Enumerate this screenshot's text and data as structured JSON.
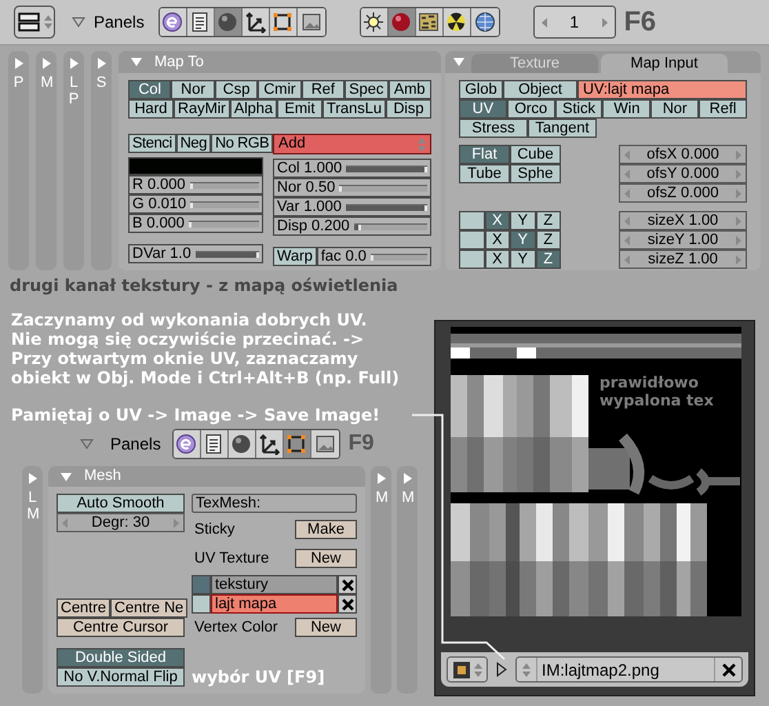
{
  "top_header": {
    "panels_label": "Panels",
    "context_buttons": [
      {
        "selected": false
      },
      {
        "selected": false
      },
      {
        "selected": true
      },
      {
        "selected": false
      },
      {
        "selected": false
      },
      {
        "selected": false
      }
    ],
    "shading_buttons": [
      {
        "selected": false
      },
      {
        "selected": true
      },
      {
        "selected": false
      },
      {
        "selected": false
      },
      {
        "selected": false
      }
    ],
    "frame": "1",
    "hotkey": "F6"
  },
  "side_tabs": [
    "P",
    "M",
    "LP",
    "S"
  ],
  "map_to": {
    "title": "Map To",
    "channels": [
      [
        {
          "label": "Col",
          "selected": true
        },
        {
          "label": "Nor",
          "selected": false
        },
        {
          "label": "Csp",
          "selected": false
        },
        {
          "label": "Cmir",
          "selected": false
        },
        {
          "label": "Ref",
          "selected": false
        },
        {
          "label": "Spec",
          "selected": false
        },
        {
          "label": "Amb",
          "selected": false
        }
      ],
      [
        {
          "label": "Hard",
          "selected": false
        },
        {
          "label": "RayMir",
          "selected": false
        },
        {
          "label": "Alpha",
          "selected": false
        },
        {
          "label": "Emit",
          "selected": false
        },
        {
          "label": "TransLu",
          "selected": false
        },
        {
          "label": "Disp",
          "selected": false
        }
      ]
    ],
    "options": [
      {
        "label": "Stenci",
        "selected": false
      },
      {
        "label": "Neg",
        "selected": false
      },
      {
        "label": "No RGB",
        "selected": false
      }
    ],
    "blend_mode": "Add",
    "color_sliders": [
      {
        "label": "R 0.000",
        "level": 0
      },
      {
        "label": "G 0.010",
        "level": 0.01
      },
      {
        "label": "B 0.000",
        "level": 0
      }
    ],
    "dvar": {
      "label": "DVar 1.0",
      "level": 1
    },
    "value_sliders": [
      {
        "label": "Col 1.000",
        "level": 1
      },
      {
        "label": "Nor 0.50",
        "level": 0.02
      },
      {
        "label": "Var 1.000",
        "level": 1
      },
      {
        "label": "Disp 0.200",
        "level": 0.1
      }
    ],
    "warp": {
      "label": "Warp",
      "selected": false
    },
    "warp_factor": {
      "label": "fac 0.0",
      "level": 0
    }
  },
  "texture": {
    "tabs": [
      {
        "label": "Texture",
        "selected": false
      },
      {
        "label": "Map Input",
        "selected": true
      }
    ],
    "coord_rows": [
      [
        {
          "label": "Glob",
          "selected": false
        },
        {
          "label": "Object",
          "selected": false
        }
      ],
      [
        {
          "label": "UV",
          "selected": true
        },
        {
          "label": "Orco",
          "selected": false
        },
        {
          "label": "Stick",
          "selected": false
        },
        {
          "label": "Win",
          "selected": false
        },
        {
          "label": "Nor",
          "selected": false
        },
        {
          "label": "Refl",
          "selected": false
        }
      ],
      [
        {
          "label": "Stress",
          "selected": false
        },
        {
          "label": "Tangent",
          "selected": false
        }
      ]
    ],
    "uv_layer": "UV:lajt mapa",
    "projection": [
      {
        "label": "Flat",
        "selected": true
      },
      {
        "label": "Cube",
        "selected": false
      },
      {
        "label": "Tube",
        "selected": false
      },
      {
        "label": "Sphe",
        "selected": false
      }
    ],
    "axes": [
      [
        {
          "label": "X",
          "selected": true
        },
        {
          "label": "Y",
          "selected": false
        },
        {
          "label": "Z",
          "selected": false
        }
      ],
      [
        {
          "label": "X",
          "selected": false
        },
        {
          "label": "Y",
          "selected": true
        },
        {
          "label": "Z",
          "selected": false
        }
      ],
      [
        {
          "label": "X",
          "selected": false
        },
        {
          "label": "Y",
          "selected": false
        },
        {
          "label": "Z",
          "selected": true
        }
      ]
    ],
    "offsets": [
      "ofsX 0.000",
      "ofsY 0.000",
      "ofsZ 0.000"
    ],
    "sizes": [
      "sizeX 1.00",
      "sizeY 1.00",
      "sizeZ 1.00"
    ]
  },
  "annotations": {
    "caption": "drugi kanał tekstury - z mapą oświetlenia",
    "intro": [
      "Zaczynamy od wykonania dobrych UV.",
      "Nie mogą się oczywiście przecinać. ->",
      "Przy otwartym oknie UV, zaznaczamy",
      "obiekt w Obj. Mode i Ctrl+Alt+B (np. Full)"
    ],
    "reminder": "Pamiętaj o UV -> Image -> Save Image!",
    "uv_note": "wybór UV [F9]"
  },
  "bottom_header": {
    "panels_label": "Panels",
    "context_buttons": [
      {
        "selected": false
      },
      {
        "selected": false
      },
      {
        "selected": false
      },
      {
        "selected": false
      },
      {
        "selected": true
      },
      {
        "selected": false
      }
    ],
    "hotkey": "F9"
  },
  "bottom_side_tabs": {
    "left": [
      "LM"
    ],
    "right": [
      "M",
      "M"
    ]
  },
  "mesh": {
    "title": "Mesh",
    "auto_smooth": {
      "label": "Auto Smooth",
      "selected": false
    },
    "degree": "Degr: 30",
    "centre_buttons": [
      "Centre",
      "Centre Ne",
      "Centre Cursor"
    ],
    "display": [
      {
        "label": "Double Sided",
        "selected": true
      },
      {
        "label": "No V.Normal Flip",
        "selected": false
      }
    ],
    "texmesh": "TexMesh:",
    "sticky": {
      "label": "Sticky",
      "button": "Make"
    },
    "uv_texture": {
      "label": "UV Texture",
      "button": "New"
    },
    "uv_layers": [
      {
        "name": "tekstury",
        "selected": false,
        "render": true
      },
      {
        "name": "lajt mapa",
        "selected": true,
        "render": false
      }
    ],
    "vertex_color": {
      "label": "Vertex Color",
      "button": "New"
    }
  },
  "image_viewer": {
    "overlay_text": [
      "prawidłowo",
      "wypalona tex"
    ],
    "image_name": "IM:lajtmap2.png"
  }
}
